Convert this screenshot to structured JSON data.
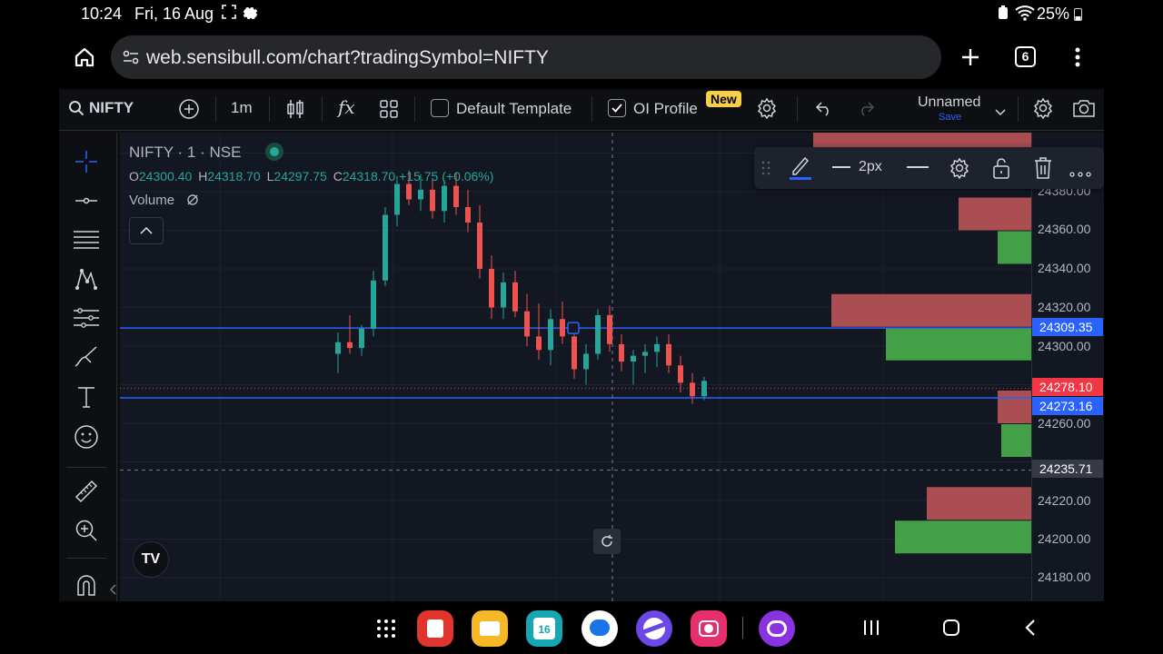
{
  "status": {
    "time": "10:24",
    "date": "Fri, 16 Aug",
    "battery": "25%"
  },
  "browser": {
    "url": "web.sensibull.com/chart?tradingSymbol=NIFTY",
    "tab_count": "6"
  },
  "toolbar": {
    "symbol": "NIFTY",
    "interval": "1m",
    "fx_label": "fx",
    "template_label": "Default Template",
    "oi_profile_label": "OI Profile",
    "new_badge": "New",
    "layout_name": "Unnamed",
    "save_label": "Save"
  },
  "legend": {
    "title": "NIFTY · 1 · NSE",
    "o_label": "O",
    "o": "24300.40",
    "h_label": "H",
    "h": "24318.70",
    "l_label": "L",
    "l": "24297.75",
    "c_label": "C",
    "c": "24318.70",
    "change": "+15.75 (+0.06%)",
    "volume_label": "Volume"
  },
  "drawing_toolbar": {
    "width_label": "2px"
  },
  "price_axis": {
    "ticks": [
      "24380.00",
      "24360.00",
      "24340.00",
      "24320.00",
      "24300.00",
      "24260.00",
      "24220.00",
      "24200.00",
      "24180.00"
    ],
    "tag_blue_top": "24309.35",
    "tag_red": "24278.10",
    "tag_blue_bottom": "24273.16",
    "tag_crosshair": "24235.71"
  },
  "colors": {
    "up": "#26a69a",
    "down": "#ef5350",
    "accent": "#2962ff",
    "oi_call": "#ab4e52",
    "oi_put": "#43a047"
  },
  "chart_data": {
    "type": "candlestick",
    "series": [
      {
        "name": "NIFTY",
        "ohlc": [
          [
            24296,
            24307,
            24286,
            24302
          ],
          [
            24302,
            24316,
            24296,
            24299
          ],
          [
            24299,
            24311,
            24295,
            24309
          ],
          [
            24309,
            24339,
            24305,
            24334
          ],
          [
            24334,
            24372,
            24331,
            24368
          ],
          [
            24368,
            24388,
            24362,
            24384
          ],
          [
            24384,
            24391,
            24373,
            24376
          ],
          [
            24376,
            24389,
            24370,
            24381
          ],
          [
            24381,
            24387,
            24366,
            24370
          ],
          [
            24370,
            24386,
            24364,
            24383
          ],
          [
            24383,
            24390,
            24368,
            24372
          ],
          [
            24372,
            24381,
            24359,
            24364
          ],
          [
            24364,
            24373,
            24335,
            24340
          ],
          [
            24340,
            24347,
            24314,
            24320
          ],
          [
            24320,
            24338,
            24314,
            24333
          ],
          [
            24333,
            24339,
            24315,
            24318
          ],
          [
            24318,
            24327,
            24300,
            24305
          ],
          [
            24305,
            24322,
            24293,
            24298
          ],
          [
            24298,
            24319,
            24290,
            24314
          ],
          [
            24314,
            24323,
            24301,
            24305
          ],
          [
            24305,
            24309,
            24283,
            24288
          ],
          [
            24288,
            24301,
            24280,
            24296
          ],
          [
            24296,
            24319,
            24293,
            24316
          ],
          [
            24316,
            24321,
            24297,
            24301
          ],
          [
            24301,
            24306,
            24287,
            24292
          ],
          [
            24292,
            24298,
            24280,
            24295
          ],
          [
            24295,
            24301,
            24286,
            24297
          ],
          [
            24297,
            24305,
            24289,
            24301
          ],
          [
            24301,
            24306,
            24286,
            24290
          ],
          [
            24290,
            24295,
            24276,
            24281
          ],
          [
            24281,
            24286,
            24270,
            24274
          ],
          [
            24274,
            24284,
            24272,
            24282
          ]
        ]
      }
    ],
    "oi_profile": [
      {
        "price": 24400,
        "calls": 240
      },
      {
        "price": 24360,
        "calls": 80,
        "puts": 37
      },
      {
        "price": 24310,
        "calls": 220,
        "puts": 160
      },
      {
        "price": 24260,
        "calls": 37,
        "puts": 33
      },
      {
        "price": 24210,
        "calls": 115,
        "puts": 150
      }
    ]
  }
}
